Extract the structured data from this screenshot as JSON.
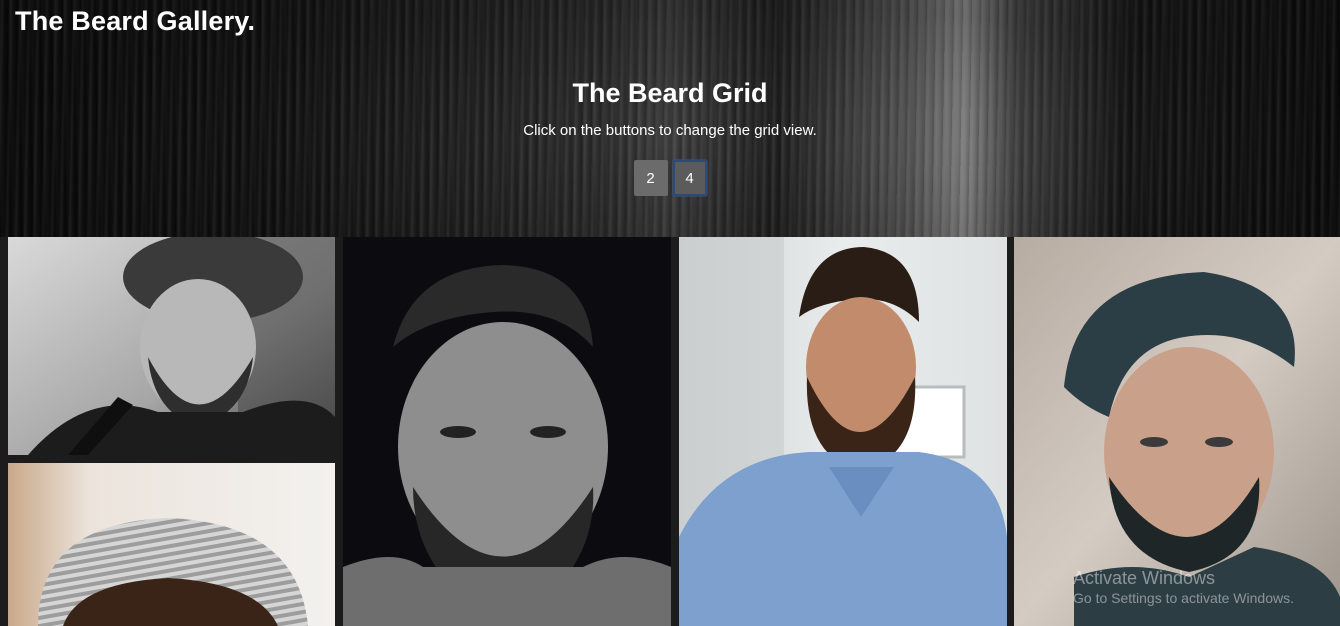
{
  "header": {
    "brand": "The Beard Gallery."
  },
  "hero": {
    "title": "The Beard Grid",
    "subtitle": "Click on the buttons to change the grid view.",
    "buttons": [
      {
        "label": "2",
        "active": false
      },
      {
        "label": "4",
        "active": true
      }
    ]
  },
  "gallery": {
    "photos": [
      {
        "name": "bearded-man-guitar-bw"
      },
      {
        "name": "man-knit-beanie"
      },
      {
        "name": "bearded-man-dark-bw"
      },
      {
        "name": "bearded-man-blue-shirt"
      },
      {
        "name": "bearded-man-undercut"
      }
    ]
  },
  "watermark": {
    "title": "Activate Windows",
    "subtitle": "Go to Settings to activate Windows."
  },
  "colors": {
    "button": "#6b6b6b",
    "button_active_border": "#2e4a78",
    "text": "#ffffff"
  }
}
